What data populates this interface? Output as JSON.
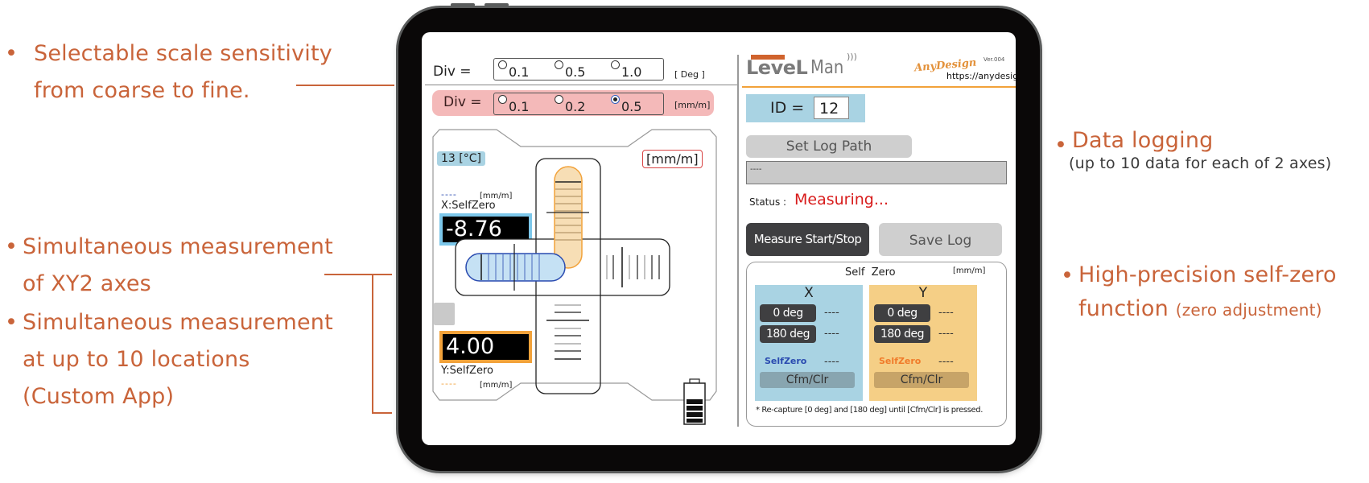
{
  "annotations": {
    "left": [
      {
        "bullet": "•",
        "lines": [
          "Selectable scale sensitivity",
          "from coarse to fine."
        ]
      },
      {
        "bullet": "•",
        "lines": [
          "Simultaneous measurement",
          "of XY2 axes"
        ]
      },
      {
        "bullet": "•",
        "lines": [
          "Simultaneous measurement",
          "at up to 10 locations",
          "(Custom App)"
        ]
      }
    ],
    "right": [
      {
        "bullet": "•",
        "title": "Data logging",
        "sub": "(up to 10 data for each of 2 axes)"
      },
      {
        "bullet": "•",
        "line1": "High-precision self-zero",
        "line2_main": "function",
        "line2_sub": "(zero adjustment)"
      }
    ]
  },
  "app": {
    "div_deg": {
      "label": "Div  =",
      "options": [
        "0.1",
        "0.5",
        "1.0"
      ],
      "selected": null,
      "unit": "[ Deg ]"
    },
    "div_mm": {
      "label": "Div  =",
      "options": [
        "0.1",
        "0.2",
        "0.5"
      ],
      "selected": "0.5",
      "unit": "[mm/m]"
    },
    "level": {
      "temperature": "13 [°C]",
      "unit_badge": "[mm/m]",
      "x": {
        "dash": "----",
        "unit": "[mm/m]",
        "label": "X:SelfZero",
        "value": "-8.76"
      },
      "y": {
        "dash": "----",
        "unit": "[mm/m]",
        "label": "Y:SelfZero",
        "value": "4.00"
      },
      "battery_level": 1.0
    },
    "brand": {
      "logo_main": "LeveL",
      "logo_suffix": "Man",
      "company": "AnyDesign",
      "url": "https://anydesign.jp",
      "version": "Ver.004"
    },
    "id": {
      "label": "ID =",
      "value": "12"
    },
    "log": {
      "set_path_label": "Set Log Path",
      "path_value": "----",
      "status_label": "Status :",
      "status_value": "Measuring...",
      "measure_label": "Measure Start/Stop",
      "save_label": "Save Log"
    },
    "self_zero": {
      "title": "Self  Zero",
      "unit": "[mm/m]",
      "x": {
        "axis": "X",
        "btn0": "0 deg",
        "val0": "----",
        "btn180": "180 deg",
        "val180": "----",
        "sz_label": "SelfZero",
        "sz_val": "----",
        "cfm": "Cfm/Clr"
      },
      "y": {
        "axis": "Y",
        "btn0": "0 deg",
        "val0": "----",
        "btn180": "180 deg",
        "val180": "----",
        "sz_label": "SelfZero",
        "sz_val": "----",
        "cfm": "Cfm/Clr"
      },
      "note": "* Re-capture [0 deg] and [180 deg] until [Cfm/Clr] is pressed."
    },
    "colors": {
      "accent_orange": "#f2a23a",
      "annotation": "#c9643a",
      "x_blue": "#a9d3e3",
      "y_orange": "#f5cf86",
      "pink_row": "#f4b9b9",
      "status_red": "#d81c1c"
    }
  }
}
